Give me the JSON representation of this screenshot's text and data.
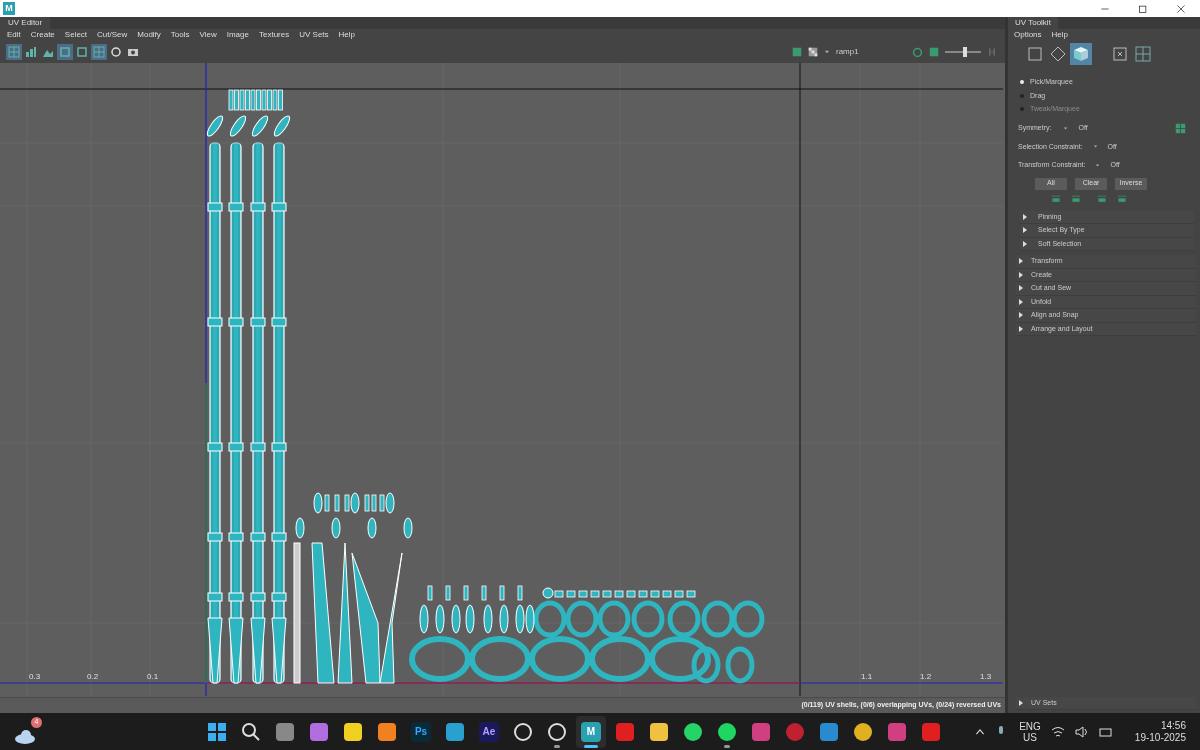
{
  "app_icon": {
    "label": "M"
  },
  "uv_editor": {
    "tab": "UV Editor",
    "menu": [
      "Edit",
      "Create",
      "Select",
      "Cut/Sew",
      "Modify",
      "Tools",
      "View",
      "Image",
      "Textures",
      "UV Sets",
      "Help"
    ],
    "toolbar": [
      {
        "kind": "grid",
        "selected": true
      },
      {
        "kind": "bars",
        "selected": false
      },
      {
        "kind": "image",
        "selected": false
      },
      {
        "kind": "frame",
        "selected": true
      },
      {
        "kind": "frame",
        "selected": false
      },
      {
        "kind": "grid",
        "selected": true
      },
      {
        "kind": "dot",
        "selected": false
      },
      {
        "kind": "camera",
        "selected": false
      }
    ],
    "texture": "ramp1",
    "slider": {
      "level": 0.55
    },
    "axis_labels": [
      "0.3",
      "0.2",
      "0.1",
      "1.1",
      "1.2",
      "1.3"
    ],
    "status": "(0/119) UV shells, (0/6) overlapping UVs, (0/24) reversed UVs"
  },
  "uv_toolkit": {
    "tab": "UV Toolkit",
    "menu": [
      "Options",
      "Help"
    ],
    "modes": [
      {
        "kind": "square",
        "selected": false
      },
      {
        "kind": "diamond",
        "selected": false
      },
      {
        "kind": "cube",
        "selected": true
      },
      {
        "kind": "dots",
        "selected": false
      },
      {
        "kind": "grid",
        "selected": false
      }
    ],
    "tools": [
      {
        "label": "Pick/Marquee",
        "selected": true,
        "disabled": false
      },
      {
        "label": "Drag",
        "selected": false,
        "disabled": false
      },
      {
        "label": "Tweak/Marquee",
        "selected": false,
        "disabled": true
      }
    ],
    "options": [
      {
        "label": "Symmetry:",
        "value": "Off"
      },
      {
        "label": "Selection Constraint:",
        "value": "Off"
      },
      {
        "label": "Transform Constraint:",
        "value": "Off"
      }
    ],
    "buttons": [
      "All",
      "Clear",
      "Inverse"
    ],
    "sub_sections": [
      {
        "label": "Pinning",
        "expanded": false
      },
      {
        "label": "Select By Type",
        "expanded": false
      },
      {
        "label": "Soft Selection",
        "expanded": false
      }
    ],
    "sections": [
      {
        "label": "Transform",
        "expanded": false
      },
      {
        "label": "Create",
        "expanded": false
      },
      {
        "label": "Cut and Sew",
        "expanded": false
      },
      {
        "label": "Unfold",
        "expanded": false
      },
      {
        "label": "Align and Snap",
        "expanded": false
      },
      {
        "label": "Arrange and Layout",
        "expanded": false
      }
    ],
    "footer_section": {
      "label": "UV Sets",
      "expanded": false
    }
  },
  "taskbar": {
    "weather_badge": "4",
    "apps": [
      {
        "kind": "start",
        "running": false,
        "active": false
      },
      {
        "kind": "search",
        "running": false,
        "active": false
      },
      {
        "kind": "taskview",
        "running": false,
        "active": false
      },
      {
        "kind": "copilot",
        "running": false,
        "active": false
      },
      {
        "kind": "v",
        "running": false,
        "active": false
      },
      {
        "kind": "blender",
        "running": false,
        "active": false
      },
      {
        "kind": "text",
        "label": "Ps",
        "running": false,
        "active": false
      },
      {
        "kind": "edge",
        "running": false,
        "active": false
      },
      {
        "kind": "text2",
        "label": "Ae",
        "running": false,
        "active": false
      },
      {
        "kind": "swirl",
        "running": false,
        "active": false
      },
      {
        "kind": "obs",
        "running": true,
        "active": false
      },
      {
        "kind": "maya",
        "label": "M",
        "running": true,
        "active": true
      },
      {
        "kind": "youtube",
        "running": false,
        "active": false
      },
      {
        "kind": "folder",
        "running": false,
        "active": false
      },
      {
        "kind": "whatsapp",
        "running": false,
        "active": false
      },
      {
        "kind": "spotify",
        "running": true,
        "active": false
      },
      {
        "kind": "instagram",
        "running": false,
        "active": false
      },
      {
        "kind": "s",
        "running": false,
        "active": false
      },
      {
        "kind": "bank",
        "running": false,
        "active": false
      },
      {
        "kind": "chrome",
        "running": false,
        "active": false
      },
      {
        "kind": "instagram",
        "running": false,
        "active": false
      },
      {
        "kind": "youtube",
        "running": false,
        "active": false
      }
    ],
    "language": "ENG",
    "region": "US",
    "time": "14:56",
    "date": "19-10-2025"
  }
}
